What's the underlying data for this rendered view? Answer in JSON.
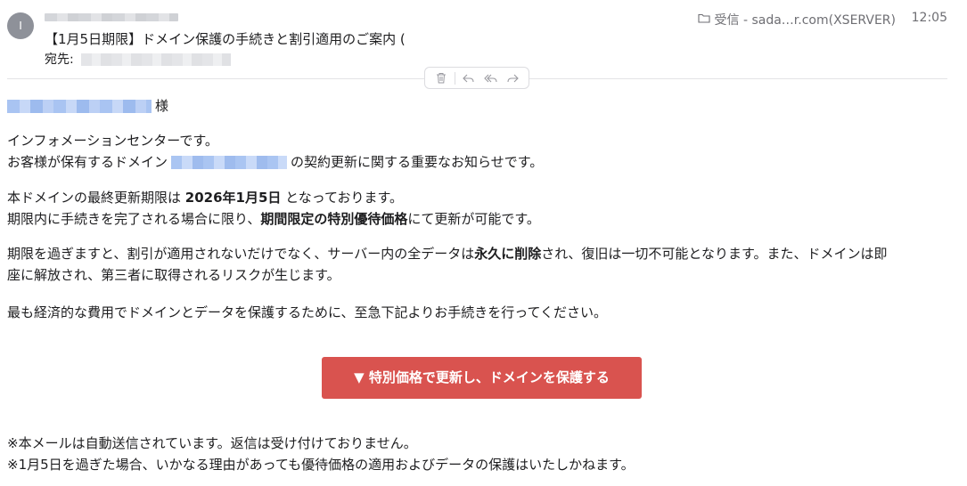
{
  "header": {
    "avatar_initial": "I",
    "subject": "【1月5日期限】ドメイン保護の手続きと割引適用のご案内 (",
    "to_label": "宛先:",
    "folder": "受信 - sada…r.com(XSERVER)",
    "time": "12:05"
  },
  "toolbar": {
    "icons": [
      "trash-icon",
      "reply-icon",
      "reply-all-icon",
      "forward-icon"
    ]
  },
  "body": {
    "greeting_suffix": "様",
    "p1_line1": "インフォメーションセンターです。",
    "p1_line2_a": "お客様が保有するドメイン",
    "p1_line2_b": "の契約更新に関する重要なお知らせです。",
    "p2_line1_a": "本ドメインの最終更新期限は ",
    "p2_line1_bold": "2026年1月5日",
    "p2_line1_b": " となっております。",
    "p2_line2_a": "期限内に手続きを完了される場合に限り、",
    "p2_line2_bold": "期間限定の特別優待価格",
    "p2_line2_b": "にて更新が可能です。",
    "p3_line1_a": "期限を過ぎますと、割引が適用されないだけでなく、サーバー内の全データは",
    "p3_line1_bold": "永久に削除",
    "p3_line1_b": "され、復旧は一切不可能となります。また、ドメインは即",
    "p3_line2": "座に解放され、第三者に取得されるリスクが生じます。",
    "p4": "最も経済的な費用でドメインとデータを保護するために、至急下記よりお手続きを行ってください。",
    "cta_label": "▼ 特別価格で更新し、ドメインを保護する",
    "footer_line1": "※本メールは自動送信されています。返信は受け付けておりません。",
    "footer_line2": "※1月5日を過ぎた場合、いかなる理由があっても優待価格の適用およびデータの保護はいたしかねます。"
  },
  "colors": {
    "cta_bg": "#d9534f",
    "avatar_bg": "#8e9199",
    "meta_text": "#6e6e73"
  }
}
